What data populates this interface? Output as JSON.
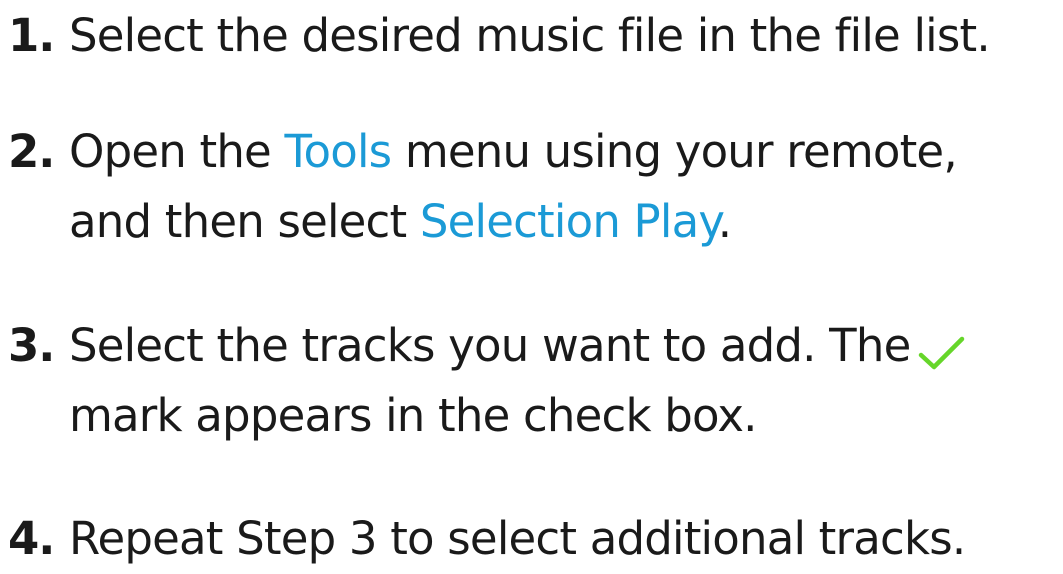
{
  "steps": [
    {
      "number": "1.",
      "line1": "Select the desired music file in the file list."
    },
    {
      "number": "2.",
      "line1_a": "Open the ",
      "line1_b": "Tools",
      "line1_c": " menu using your remote,",
      "line2_a": "and then select ",
      "line2_b": "Selection Play",
      "line2_c": "."
    },
    {
      "number": "3.",
      "line1": "Select the tracks you want to add. The",
      "check_icon": "checkmark-icon",
      "line2": "mark appears in the check box."
    },
    {
      "number": "4.",
      "line1": "Repeat Step 3 to select additional tracks."
    }
  ],
  "colors": {
    "text": "#1a1a1a",
    "highlight": "#1b9ad6",
    "check": "#66d62a"
  }
}
